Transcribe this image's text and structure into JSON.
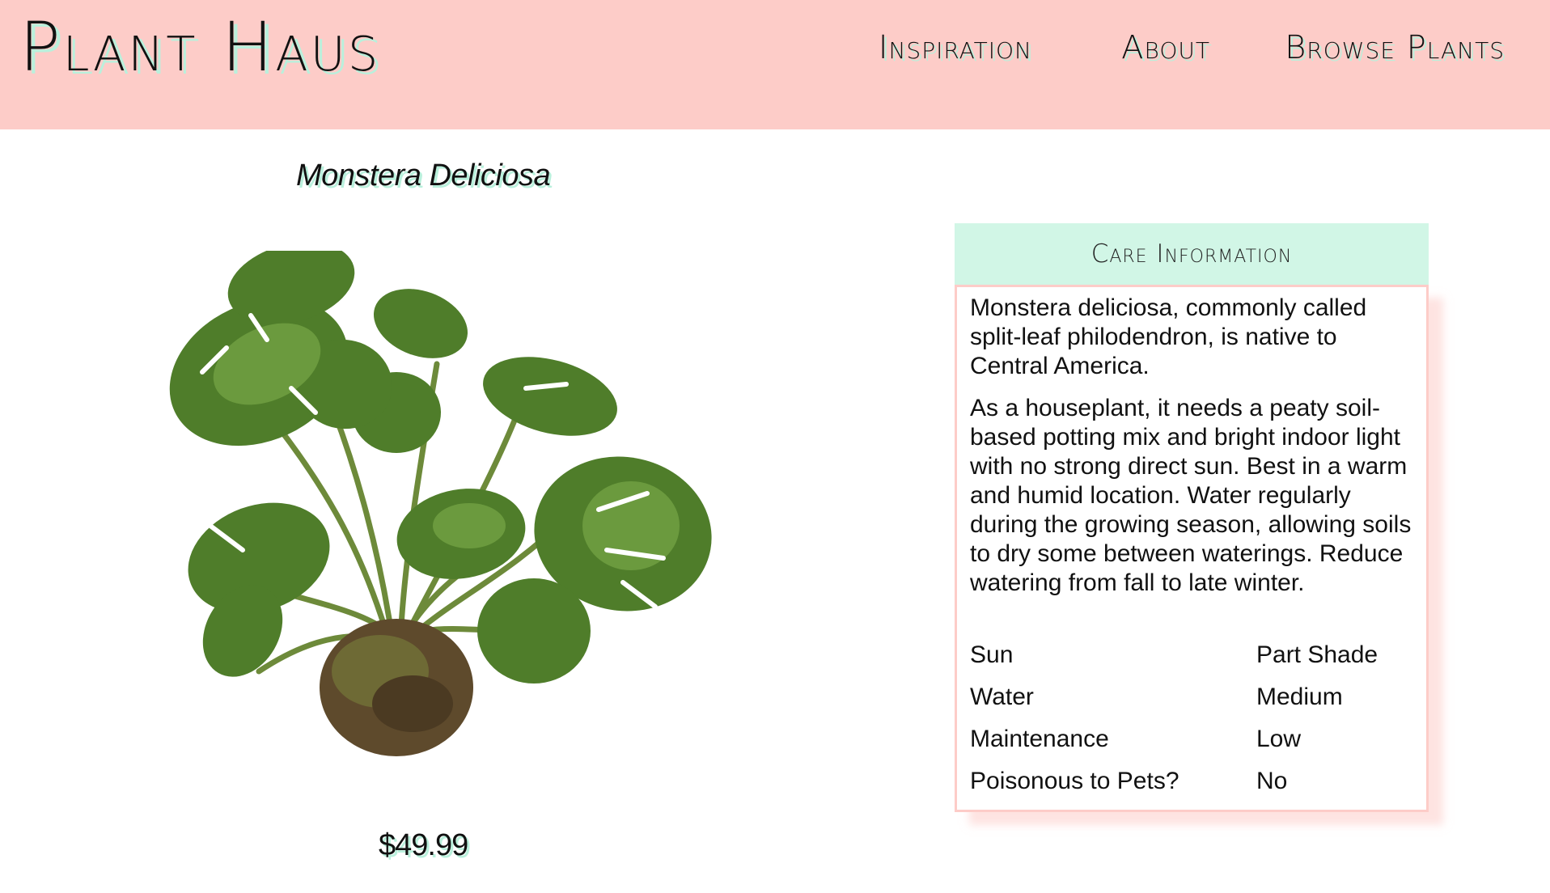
{
  "header": {
    "brand": "Plant Haus",
    "nav": [
      {
        "label": "Inspiration"
      },
      {
        "label": "About"
      },
      {
        "label": "Browse Plants"
      }
    ]
  },
  "product": {
    "name": "Monstera Deliciosa",
    "price": "$49.99",
    "image_icon": "monstera-plant-image"
  },
  "care": {
    "heading": "Care Information",
    "paragraphs": [
      "Monstera deliciosa, commonly called split-leaf philodendron, is native to Central America.",
      "As a houseplant, it needs a peaty soil-based potting mix and bright indoor light with no strong direct sun. Best in a warm and humid location. Water regularly during the growing season, allowing soils to dry some between waterings. Reduce watering from fall to late winter."
    ],
    "facts": [
      {
        "label": "Sun",
        "value": "Part Shade"
      },
      {
        "label": "Water",
        "value": "Medium"
      },
      {
        "label": "Maintenance",
        "value": "Low"
      },
      {
        "label": "Poisonous to Pets?",
        "value": "No"
      }
    ]
  },
  "colors": {
    "header_bg": "#fdccc8",
    "accent_mint": "#b9f0dc",
    "care_header_bg": "#d1f6e6"
  }
}
